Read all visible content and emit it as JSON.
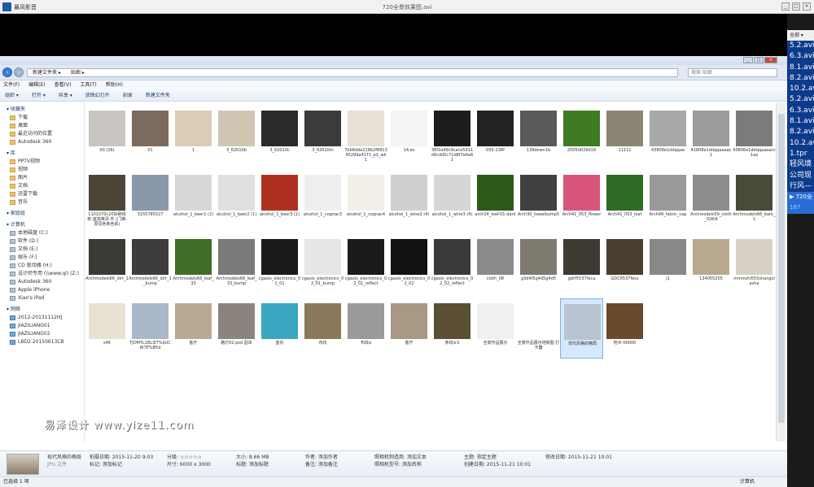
{
  "player": {
    "app_name": "暴风影音",
    "file_title": "720全景效果图.avi",
    "playlist_header": "全部",
    "playlist": [
      "5.2.avi",
      "6.3.avi",
      "8.1.avi",
      "8.2.avi",
      "10.2.avi",
      "5.2.avi",
      "6.3.avi",
      "8.1.avi",
      "8.2.avi",
      "10.2.avi",
      "1.tpr",
      "轻风境",
      "公司现",
      "行风—"
    ],
    "playlist_selected": "720全",
    "playlist_selected_time": "167"
  },
  "explorer": {
    "breadcrumbs": [
      "新建文件夹",
      "贴图"
    ],
    "search_placeholder": "搜索 贴图",
    "menu": [
      "文件(F)",
      "编辑(E)",
      "查看(V)",
      "工具(T)",
      "帮助(H)"
    ],
    "toolbar": [
      "组织 ▾",
      "打开 ▾",
      "共享 ▾",
      "放映幻灯片",
      "刻录",
      "新建文件夹"
    ],
    "sidebar": {
      "favorites": {
        "head": "收藏夹",
        "items": [
          "下载",
          "桌面",
          "最近访问的位置",
          "Autodesk 360"
        ]
      },
      "libraries": {
        "head": "库",
        "items": [
          "PPTV视频",
          "视频",
          "图片",
          "文档",
          "迅雷下载",
          "音乐"
        ]
      },
      "homegroup": {
        "head": "家庭组",
        "items": []
      },
      "computer": {
        "head": "计算机",
        "items": [
          "本地磁盘 (C:)",
          "软件 (D:)",
          "文档 (E:)",
          "娱乐 (F:)",
          "CD 驱动器 (H:)",
          "设计师专用 (\\\\www.qi) (Z:)",
          "Autodesk 360",
          "Apple iPhone",
          "Xiao's iPad"
        ]
      },
      "network": {
        "head": "网络",
        "items": [
          "2012-20131112HJ",
          "JIAZILIANG01",
          "JIAZILIANG02",
          "LBD2 20150613CB"
        ]
      }
    },
    "files": [
      {
        "label": "00 (26)",
        "color": "#c9c6c1"
      },
      {
        "label": "01",
        "color": "#7c6a5c"
      },
      {
        "label": "1",
        "color": "#d9cdb8"
      },
      {
        "label": "3_62010b",
        "color": "#cfc7b4"
      },
      {
        "label": "3_62010c",
        "color": "#2a2a2a"
      },
      {
        "label": "3_62010m",
        "color": "#3b3b3b"
      },
      {
        "label": "7bb8dde218b2f881345299a4171_p1_wk1",
        "color": "#e6e0d6"
      },
      {
        "label": "14.es",
        "color": "#f4f4f4"
      },
      {
        "label": "36f2a49c9cace5011d9cdd5c71d8f7e6a61",
        "color": "#1d1d1d"
      },
      {
        "label": "055-138f",
        "color": "#222"
      },
      {
        "label": "139down1b",
        "color": "#5a5a5a"
      },
      {
        "label": "2005d029d19",
        "color": "#3d7a22"
      },
      {
        "label": "11111",
        "color": "#8c8574"
      },
      {
        "label": "43808e1ddqqaa",
        "color": "#a8a8a8"
      },
      {
        "label": "41808e1ddqqaaaac1",
        "color": "#9b9b9b"
      },
      {
        "label": "43806e1ddqqaaaacc1aa",
        "color": "#7b7b7b"
      },
      {
        "label": "1101070c20杂刷线条-室高等清 件 (门梯-原同色条色系)",
        "color": "#4b4538"
      },
      {
        "label": "3155785527",
        "color": "#8899aa"
      },
      {
        "label": "alcohol_1_beer1 (2)",
        "color": "#d8d8d8"
      },
      {
        "label": "alcohol_1_beer2 (1)",
        "color": "#e0e0e0"
      },
      {
        "label": "alcohol_1_beer3 (1)",
        "color": "#b03020"
      },
      {
        "label": "alcohol_1_cognac3",
        "color": "#eeeeee"
      },
      {
        "label": "alcohol_1_cognac4",
        "color": "#f2efe6"
      },
      {
        "label": "alcohol_1_wine2 (4)",
        "color": "#cfcfcf"
      },
      {
        "label": "alcohol_1_wine3 (4)",
        "color": "#d6d6d6"
      },
      {
        "label": "arch24_leaf-01-dark",
        "color": "#2c5a1a"
      },
      {
        "label": "Arch30_towelbump5",
        "color": "#404040"
      },
      {
        "label": "Arch41_053_flower",
        "color": "#d9557a"
      },
      {
        "label": "Arch41_053_leaf",
        "color": "#2e6b24"
      },
      {
        "label": "Arch49_fabric_cap",
        "color": "#9a9a9a"
      },
      {
        "label": "Archmodels59_cloth_026i4",
        "color": "#8d8d8d"
      },
      {
        "label": "Archmodels66_bark_1",
        "color": "#4a4a3a"
      },
      {
        "label": "Archmodels66_dirt_1",
        "color": "#3a3a36"
      },
      {
        "label": "Archmodels66_dirt_1_bump",
        "color": "#3d3d3d"
      },
      {
        "label": "Archmodels66_leaf_33",
        "color": "#3f6d2a"
      },
      {
        "label": "Archmodels66_leaf_33_bump",
        "color": "#7a7a7a"
      },
      {
        "label": "cgaxis_electronics_02_01",
        "color": "#1a1a1a"
      },
      {
        "label": "cgaxis_electronics_02_01_bump",
        "color": "#e6e6e6"
      },
      {
        "label": "cgaxis_electronics_02_01_reflect",
        "color": "#1b1b1b"
      },
      {
        "label": "cgaxis_electronics_02_02",
        "color": "#111"
      },
      {
        "label": "cgaxis_electronics_02_02_reflect",
        "color": "#3a3a3a"
      },
      {
        "label": "cloth_08",
        "color": "#8a8a8a"
      },
      {
        "label": "g3d4f5g4d5g4d5",
        "color": "#7e7a70"
      },
      {
        "label": "gdrf5537faca",
        "color": "#3e3a32"
      },
      {
        "label": "GDC6537fess",
        "color": "#4a3e30"
      },
      {
        "label": "j1",
        "color": "#888"
      },
      {
        "label": "134055205",
        "color": "#b8a890"
      },
      {
        "label": "mmmshi555shangxiasha",
        "color": "#d8d0c4"
      },
      {
        "label": "s46",
        "color": "#e8e2d2"
      },
      {
        "label": "TJOMYL18L3IT%$UCW7E%B5d",
        "color": "#a8b8c8"
      },
      {
        "label": "客厅",
        "color": "#b8a894"
      },
      {
        "label": "路灯02.psd 副本",
        "color": "#8a847c"
      },
      {
        "label": "室内",
        "color": "#3aa6c0"
      },
      {
        "label": "布纹",
        "color": "#8a7858"
      },
      {
        "label": "布纹a",
        "color": "#9a9a9a"
      },
      {
        "label": "客厅",
        "color": "#a89884"
      },
      {
        "label": "条纹sr2",
        "color": "#5a4e34"
      },
      {
        "label": "全景作品展示",
        "color": "#f0f0f0"
      },
      {
        "label": "全景作品展示地板图 打卡器",
        "color": "#ffffff"
      },
      {
        "label": "现代风格的格局",
        "color": "#b8c4d0"
      },
      {
        "label": "地木-00000",
        "color": "#6a4a2a"
      }
    ],
    "selected_file": "现代风格的格局",
    "details": {
      "name": "现代风格的格局",
      "type": "JPG 文件",
      "taken": "拍摄日期: 2015-11-20 9:03",
      "tags": "标记: 添加标记",
      "rating": "分级: ☆☆☆☆☆",
      "dims": "尺寸: 6000 x 3000",
      "size": "大小: 8.66 MB",
      "title": "标题: 添加标题",
      "author": "作者: 添加作者",
      "comment": "备注: 添加备注",
      "camera": "照相机制造商: 添加文本",
      "camera_model": "照相机型号: 添加名称",
      "subject": "主题: 指定主题",
      "created": "创建日期: 2015-11-21 10:01",
      "modified": "修改日期: 2015-11-21 10:01"
    },
    "status_left": "已选择 1 项",
    "status_right": "计算机"
  },
  "watermark": "易泽设计 www.yize11.com"
}
